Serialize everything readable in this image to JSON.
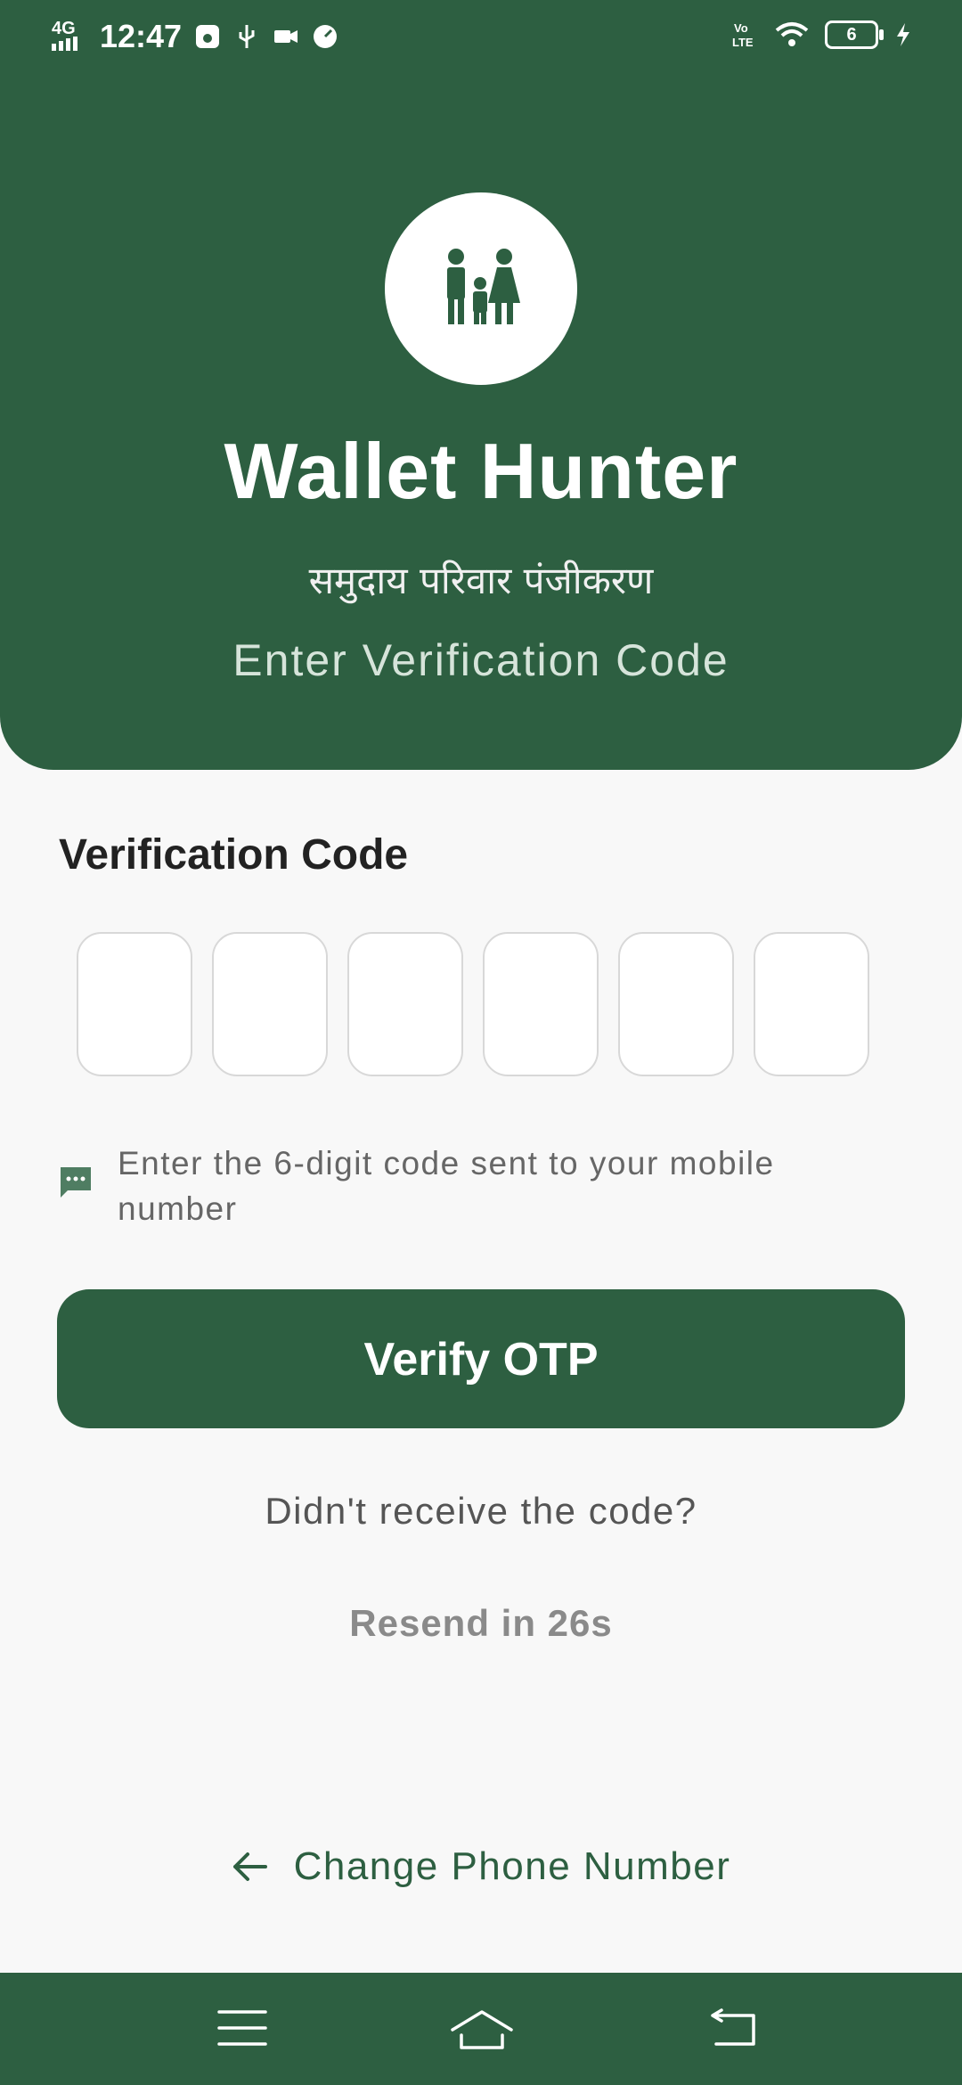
{
  "status_bar": {
    "network": "4G",
    "time": "12:47",
    "battery": "6"
  },
  "header": {
    "app_title": "Wallet Hunter",
    "subtitle": "समुदाय परिवार पंजीकरण",
    "tagline": "Enter Verification Code",
    "logo_icon": "family-icon"
  },
  "form": {
    "label": "Verification Code",
    "otp_digits": [
      "",
      "",
      "",
      "",
      "",
      ""
    ],
    "hint": "Enter the 6-digit code sent to your mobile number",
    "verify_label": "Verify OTP",
    "didnt_receive": "Didn't receive the code?",
    "resend": "Resend in 26s",
    "change_phone": "Change Phone Number"
  },
  "colors": {
    "primary": "#2d5f41",
    "background": "#f8f8f8"
  }
}
